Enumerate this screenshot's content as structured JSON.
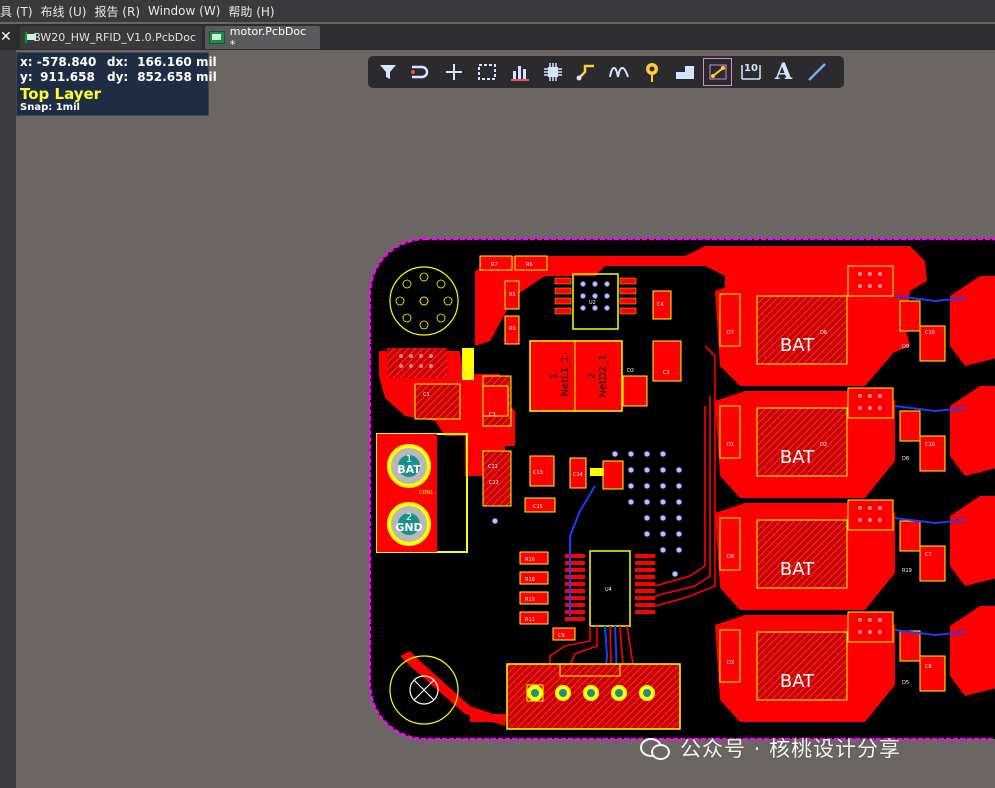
{
  "menu": [
    "具 (T)",
    "布线 (U)",
    "报告 (R)",
    "Window (W)",
    "帮助 (H)"
  ],
  "tabs": [
    {
      "label": "BW20_HW_RFID_V1.0.PcbDoc",
      "active": false
    },
    {
      "label": "motor.PcbDoc *",
      "active": true
    }
  ],
  "coords": {
    "x_label": "x:",
    "x_value": "-578.840",
    "dx_label": "dx:",
    "dx_value": "166.160 mil",
    "y_label": "y:",
    "y_value": "911.658",
    "dy_label": "dy:",
    "dy_value": "852.658 mil",
    "layer": "Top Layer",
    "snap": "Snap: 1mil"
  },
  "toolbar_icons": [
    "filter-icon",
    "route-icon",
    "cross-icon",
    "select-rect-icon",
    "chart-icon",
    "component-icon",
    "interactive-route-icon",
    "diff-pair-icon",
    "via-icon",
    "fill-icon",
    "connection-icon",
    "dimension-icon",
    "text-icon",
    "line-icon"
  ],
  "toolbar_glyphs": {
    "dimension": "10",
    "text": "A"
  },
  "pcb": {
    "mosfet_labels": [
      "BAT",
      "BAT",
      "BAT",
      "BAT"
    ],
    "net_labels": [
      "1\nNetL1_1",
      "2\nNetD2_1"
    ],
    "connector_pads": [
      "1\nBAT",
      "2\nGND"
    ],
    "con_label": "CON1",
    "silk_labels": [
      "R7",
      "R6",
      "R5",
      "R9",
      "C4",
      "U2",
      "C1",
      "C2",
      "D2",
      "C3",
      "C11",
      "C12",
      "C13",
      "C14",
      "C15",
      "R16",
      "R18",
      "R19",
      "R11",
      "C9",
      "U4",
      "D7",
      "D1",
      "D8",
      "D3",
      "D9",
      "D8",
      "C16",
      "C10",
      "C7",
      "C8",
      "R19",
      "D5",
      "D6",
      "D2"
    ]
  },
  "watermark": "公众号 · 核桃设计分享",
  "colors": {
    "board": "#000000",
    "copper": "#ff0000",
    "silk": "#ffff00",
    "outline": "#ff00ff",
    "trace_bottom": "#1a3dff"
  }
}
